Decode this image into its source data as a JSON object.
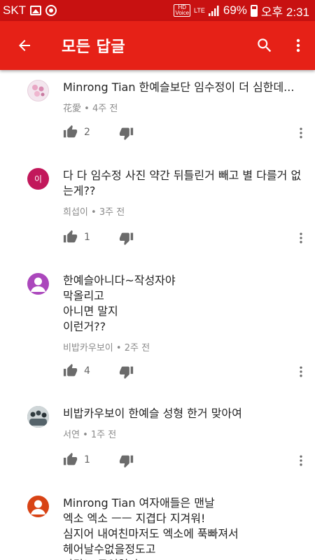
{
  "status": {
    "carrier": "SKT",
    "hd_label": "HD\nVoice",
    "network": "LTE",
    "battery": "69%",
    "time": "오후 2:31"
  },
  "appbar": {
    "title": "모든 답글",
    "color": "#e62117"
  },
  "comments": [
    {
      "text": "Minrong Tian 한예슬보단 임수정이 더 심한데...",
      "author": "花愛",
      "age": "4주 전",
      "likes": "2",
      "avatar_color": "#f3e6ee",
      "avatar_letter": ""
    },
    {
      "text": "다 다 임수정 사진 약간 뒤틀린거 빼고 별 다를거 없는게??",
      "author": "희섭이",
      "age": "3주 전",
      "likes": "1",
      "avatar_color": "#c2185b",
      "avatar_letter": "이"
    },
    {
      "text": "한예슬아니다~작성자야\n막올리고\n아니면 말지\n이런거??",
      "author": "비밥카우보이",
      "age": "2주 전",
      "likes": "4",
      "avatar_color": "#ab47bc",
      "avatar_letter": ""
    },
    {
      "text": "비밥카우보이 한예슬 성형 한거 맞아여",
      "author": "서연",
      "age": "1주 전",
      "likes": "1",
      "avatar_color": "#7d8a8f",
      "avatar_letter": ""
    },
    {
      "text": "Minrong Tian 여자애들은 맨날\n엑소 엑소 ㅡㅡ 지겹다 지겨워!\n심지어 내여친마저도 엑소에 푹빠져서\n헤어날수없을정도고\n나랑노 무엇일까",
      "author": "",
      "age": "",
      "likes": "",
      "avatar_color": "#d84315",
      "avatar_letter": ""
    }
  ],
  "separator": "•"
}
